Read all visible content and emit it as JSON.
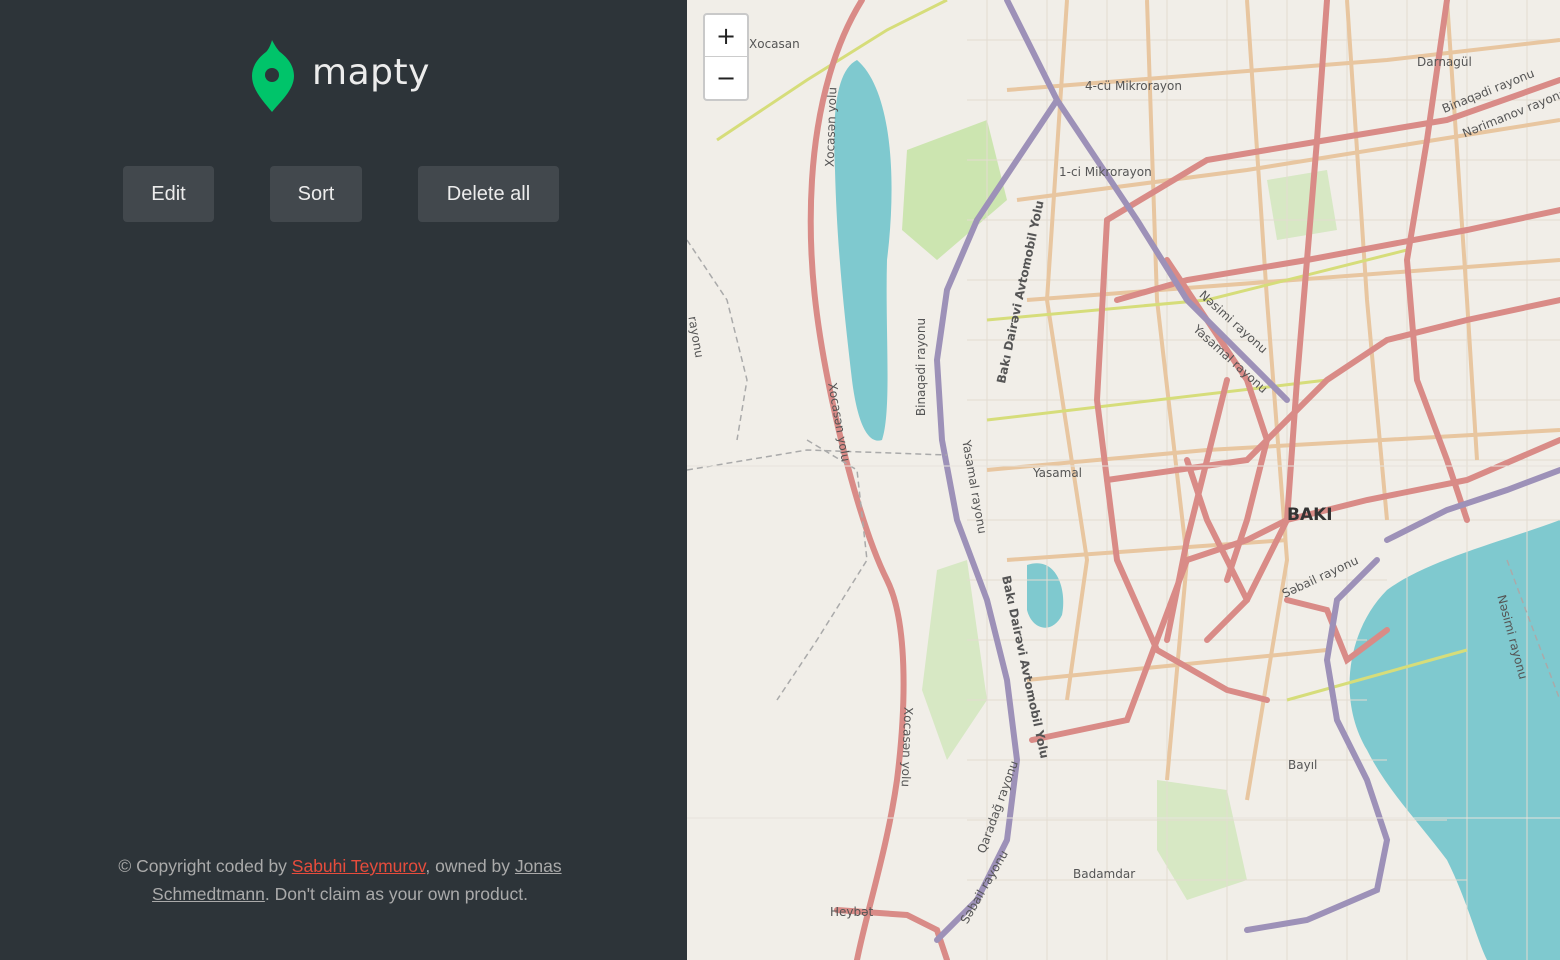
{
  "app": {
    "logo_text": "mapty",
    "logo_icon": "map-pin-icon",
    "accent": "#00c46a"
  },
  "toolbar": {
    "edit_label": "Edit",
    "sort_label": "Sort",
    "delete_all_label": "Delete all"
  },
  "footer": {
    "prefix": "© Copyright coded by ",
    "author": "Sabuhi Teymurov",
    "middle": ", owned by ",
    "owner": "Jonas Schmedtmann",
    "suffix": ". Don't claim as your own product."
  },
  "map_controls": {
    "zoom_in": "+",
    "zoom_out": "−"
  },
  "map_labels": {
    "city": "BAKI",
    "xocasan": "Xocasan",
    "darnagul": "Darnagül",
    "binaqadi": "Binaqədi rayonu",
    "narimanov": "Nərimanov rayonu",
    "mikro4": "4-cü Mikrorayon",
    "mikro1": "1-ci Mikrorayon",
    "nasimi": "Nəsimi rayonu",
    "nasimi2": "Nəsimi rayonu",
    "yasamal_r": "Yasamal rayonu",
    "yasamal_r2": "Yasamal rayonu",
    "yasamal": "Yasamal",
    "sabail": "Səbail rayonu",
    "sabail2": "Səbail rayonu",
    "binaqadi2": "Binaqədi rayonu",
    "ring": "Bakı Dairəvi Avtomobil Yolu",
    "ring2": "Bakı Dairəvi Avtomobil Yolu",
    "xocasan_yolu": "Xocasən yolu",
    "xocasan_yolu2": "Xocasən yolu",
    "xocasan_yolu3": "Xocasən yolu",
    "qaradag": "Qaradağ rayonu",
    "bayil": "Bayıl",
    "badamdar": "Badamdar",
    "heybat": "Heybət",
    "rayonu": "rayonu"
  },
  "colors": {
    "sidebar_bg": "#2d3439",
    "button_bg": "#42484d",
    "water": "#7fc9cf",
    "road_major": "#d98b87",
    "road_motorway": "#9d91b8",
    "road_minor": "#e8c6a0",
    "greenery": "#cce5b0"
  }
}
